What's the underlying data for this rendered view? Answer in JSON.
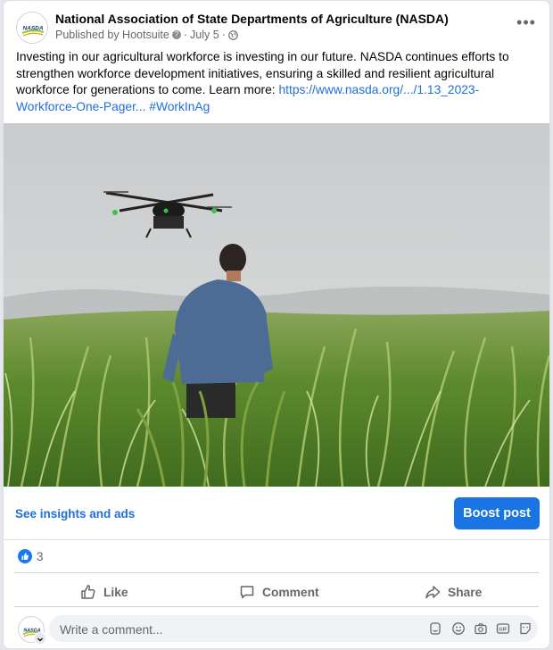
{
  "post": {
    "page_name": "National Association of State Departments of Agriculture (NASDA)",
    "publisher": "Published by Hootsuite",
    "date": "July 5",
    "separator": "·",
    "avatar_text": "NASDA",
    "more_label": "•••",
    "text_main": "Investing in our agricultural workforce is investing in our future. NASDA continues efforts to strengthen workforce development initiatives, ensuring a skilled and resilient agricultural workforce for generations to come. Learn more: ",
    "link_text": "https://www.nasda.org/.../1.13_2023-Workforce-One-Pager...",
    "hashtag": "#WorkInAg",
    "image_icon": "drone-field-photo"
  },
  "insights": {
    "link_label": "See insights and ads",
    "boost_label": "Boost post"
  },
  "reactions": {
    "count": "3",
    "icon": "like-icon"
  },
  "actions": {
    "like": "Like",
    "comment": "Comment",
    "share": "Share"
  },
  "comment_box": {
    "placeholder": "Write a comment...",
    "tools": [
      "avatar-sticker-icon",
      "emoji-icon",
      "camera-icon",
      "gif-icon",
      "sticker-icon"
    ]
  },
  "colors": {
    "accent": "#1b74e4",
    "link": "#216fdb",
    "muted": "#65676b"
  }
}
